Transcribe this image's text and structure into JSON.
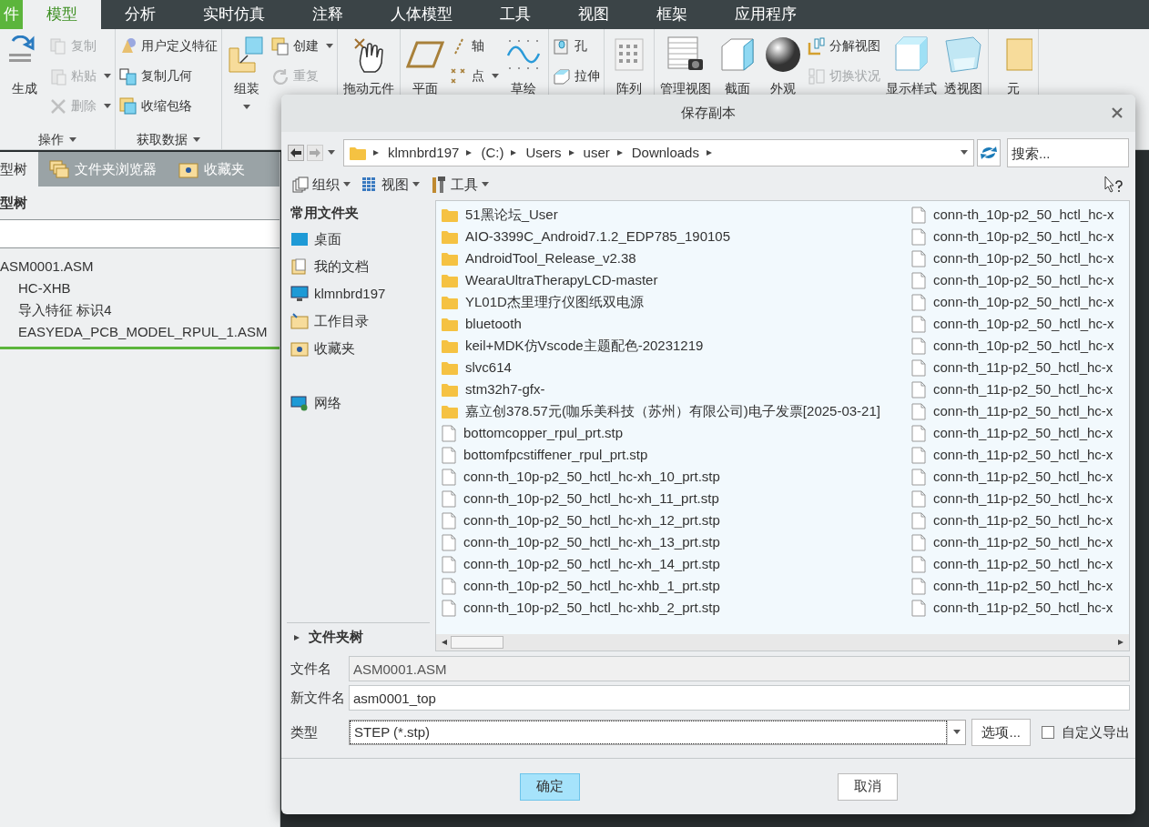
{
  "menu_tabs": [
    {
      "label": "件",
      "kind": "file",
      "selected": false
    },
    {
      "label": "模型",
      "kind": "tab",
      "selected": true
    },
    {
      "label": "分析",
      "kind": "tab",
      "selected": false
    },
    {
      "label": "实时仿真",
      "kind": "tab",
      "selected": false
    },
    {
      "label": "注释",
      "kind": "tab",
      "selected": false
    },
    {
      "label": "人体模型",
      "kind": "tab",
      "selected": false
    },
    {
      "label": "工具",
      "kind": "tab",
      "selected": false
    },
    {
      "label": "视图",
      "kind": "tab",
      "selected": false
    },
    {
      "label": "框架",
      "kind": "tab",
      "selected": false
    },
    {
      "label": "应用程序",
      "kind": "tab",
      "selected": false
    }
  ],
  "ribbon": {
    "groups": [
      {
        "label": "操作",
        "columns": [
          [
            {
              "label": "生成",
              "kind": "large",
              "disabled": false,
              "dropdown": false
            }
          ],
          [
            {
              "label": "复制",
              "kind": "small",
              "disabled": true,
              "dropdown": false
            },
            {
              "label": "粘贴",
              "kind": "small",
              "disabled": true,
              "dropdown": true
            },
            {
              "label": "删除",
              "kind": "small",
              "disabled": true,
              "dropdown": true
            }
          ]
        ]
      },
      {
        "label": "获取数据",
        "columns": [
          [
            {
              "label": "用户定义特征",
              "kind": "small",
              "disabled": false,
              "dropdown": false
            },
            {
              "label": "复制几何",
              "kind": "small",
              "disabled": false,
              "dropdown": false
            },
            {
              "label": "收缩包络",
              "kind": "small",
              "disabled": false,
              "dropdown": false
            }
          ]
        ]
      },
      {
        "columns": [
          [
            {
              "label": "组装",
              "kind": "large",
              "disabled": false,
              "dropdown": true
            }
          ],
          [
            {
              "label": "创建",
              "kind": "small",
              "disabled": false,
              "dropdown": true
            },
            {
              "label": "重复",
              "kind": "small",
              "disabled": true,
              "dropdown": false
            }
          ]
        ]
      },
      {
        "columns": [
          [
            {
              "label": "拖动元件",
              "kind": "large",
              "disabled": false,
              "dropdown": false
            }
          ]
        ]
      },
      {
        "columns": [
          [
            {
              "label": "平面",
              "kind": "large",
              "disabled": false,
              "dropdown": false
            }
          ],
          [
            {
              "label": "轴",
              "kind": "small",
              "disabled": false,
              "dropdown": false
            },
            {
              "label": "点",
              "kind": "small",
              "disabled": false,
              "dropdown": true
            }
          ],
          [
            {
              "label": "草绘",
              "kind": "large",
              "disabled": false,
              "dropdown": false
            }
          ]
        ]
      },
      {
        "columns": [
          [
            {
              "label": "孔",
              "kind": "small",
              "disabled": false,
              "dropdown": false
            },
            {
              "label": "拉伸",
              "kind": "small",
              "disabled": false,
              "dropdown": false
            }
          ]
        ]
      },
      {
        "columns": [
          [
            {
              "label": "阵列",
              "kind": "large",
              "disabled": false,
              "dropdown": false
            }
          ]
        ]
      },
      {
        "columns": [
          [
            {
              "label": "管理视图",
              "kind": "large",
              "disabled": false,
              "dropdown": false
            }
          ],
          [
            {
              "label": "截面",
              "kind": "large",
              "disabled": false,
              "dropdown": false
            }
          ],
          [
            {
              "label": "外观",
              "kind": "large",
              "disabled": false,
              "dropdown": false
            }
          ],
          [
            {
              "label": "分解视图",
              "kind": "small",
              "disabled": false,
              "dropdown": false
            },
            {
              "label": "切换状况",
              "kind": "small",
              "disabled": true,
              "dropdown": false
            }
          ],
          [
            {
              "label": "显示样式",
              "kind": "large",
              "disabled": false,
              "dropdown": false
            }
          ],
          [
            {
              "label": "透视图",
              "kind": "large",
              "disabled": false,
              "dropdown": false
            }
          ]
        ]
      },
      {
        "columns": [
          [
            {
              "label": "元",
              "kind": "large",
              "disabled": false,
              "dropdown": false
            }
          ]
        ]
      }
    ]
  },
  "left_panel": {
    "tabs": [
      {
        "label": "型树",
        "selected": true
      },
      {
        "label": "文件夹浏览器",
        "selected": false
      },
      {
        "label": "收藏夹",
        "selected": false
      }
    ],
    "heading": "型树",
    "tree": [
      {
        "label": "ASM0001.ASM",
        "children": [
          {
            "label": "HC-XHB"
          },
          {
            "label": "导入特征 标识4"
          },
          {
            "label": "EASYEDA_PCB_MODEL_RPUL_1.ASM"
          }
        ]
      }
    ]
  },
  "dialog": {
    "title": "保存副本",
    "address": [
      "klmnbrd197",
      "(C:)",
      "Users",
      "user",
      "Downloads"
    ],
    "search": {
      "placeholder": "搜索..."
    },
    "toolbar": [
      "组织",
      "视图",
      "工具"
    ],
    "nav": {
      "heading": "常用文件夹",
      "items": [
        {
          "label": "桌面"
        },
        {
          "label": "我的文档"
        },
        {
          "label": "klmnbrd197"
        },
        {
          "label": "工作目录"
        },
        {
          "label": "收藏夹"
        }
      ],
      "network_items": [
        {
          "label": "网络"
        }
      ],
      "folder_tree": "文件夹树"
    },
    "files": {
      "column_1": [
        {
          "name": "51黑论坛_User",
          "kind": "folder"
        },
        {
          "name": "AIO-3399C_Android7.1.2_EDP785_190105",
          "kind": "folder"
        },
        {
          "name": "AndroidTool_Release_v2.38",
          "kind": "folder"
        },
        {
          "name": "WearaUltraTherapyLCD-master",
          "kind": "folder"
        },
        {
          "name": "YL01D杰里理疗仪图纸双电源",
          "kind": "folder"
        },
        {
          "name": "bluetooth",
          "kind": "folder"
        },
        {
          "name": "keil+MDK仿Vscode主题配色-20231219",
          "kind": "folder"
        },
        {
          "name": "slvc614",
          "kind": "folder"
        },
        {
          "name": "stm32h7-gfx-",
          "kind": "folder"
        },
        {
          "name": "嘉立创378.57元(咖乐美科技（苏州）有限公司)电子发票[2025-03-21]",
          "kind": "folder"
        },
        {
          "name": "bottomcopper_rpul_prt.stp",
          "kind": "file"
        },
        {
          "name": "bottomfpcstiffener_rpul_prt.stp",
          "kind": "file"
        },
        {
          "name": "conn-th_10p-p2_50_hctl_hc-xh_10_prt.stp",
          "kind": "file"
        },
        {
          "name": "conn-th_10p-p2_50_hctl_hc-xh_11_prt.stp",
          "kind": "file"
        },
        {
          "name": "conn-th_10p-p2_50_hctl_hc-xh_12_prt.stp",
          "kind": "file"
        },
        {
          "name": "conn-th_10p-p2_50_hctl_hc-xh_13_prt.stp",
          "kind": "file"
        },
        {
          "name": "conn-th_10p-p2_50_hctl_hc-xh_14_prt.stp",
          "kind": "file"
        },
        {
          "name": "conn-th_10p-p2_50_hctl_hc-xhb_1_prt.stp",
          "kind": "file"
        },
        {
          "name": "conn-th_10p-p2_50_hctl_hc-xhb_2_prt.stp",
          "kind": "file"
        }
      ],
      "column_2": [
        {
          "name": "conn-th_10p-p2_50_hctl_hc-x",
          "kind": "file"
        },
        {
          "name": "conn-th_10p-p2_50_hctl_hc-x",
          "kind": "file"
        },
        {
          "name": "conn-th_10p-p2_50_hctl_hc-x",
          "kind": "file"
        },
        {
          "name": "conn-th_10p-p2_50_hctl_hc-x",
          "kind": "file"
        },
        {
          "name": "conn-th_10p-p2_50_hctl_hc-x",
          "kind": "file"
        },
        {
          "name": "conn-th_10p-p2_50_hctl_hc-x",
          "kind": "file"
        },
        {
          "name": "conn-th_10p-p2_50_hctl_hc-x",
          "kind": "file"
        },
        {
          "name": "conn-th_11p-p2_50_hctl_hc-x",
          "kind": "file"
        },
        {
          "name": "conn-th_11p-p2_50_hctl_hc-x",
          "kind": "file"
        },
        {
          "name": "conn-th_11p-p2_50_hctl_hc-x",
          "kind": "file"
        },
        {
          "name": "conn-th_11p-p2_50_hctl_hc-x",
          "kind": "file"
        },
        {
          "name": "conn-th_11p-p2_50_hctl_hc-x",
          "kind": "file"
        },
        {
          "name": "conn-th_11p-p2_50_hctl_hc-x",
          "kind": "file"
        },
        {
          "name": "conn-th_11p-p2_50_hctl_hc-x",
          "kind": "file"
        },
        {
          "name": "conn-th_11p-p2_50_hctl_hc-x",
          "kind": "file"
        },
        {
          "name": "conn-th_11p-p2_50_hctl_hc-x",
          "kind": "file"
        },
        {
          "name": "conn-th_11p-p2_50_hctl_hc-x",
          "kind": "file"
        },
        {
          "name": "conn-th_11p-p2_50_hctl_hc-x",
          "kind": "file"
        },
        {
          "name": "conn-th_11p-p2_50_hctl_hc-x",
          "kind": "file"
        }
      ]
    },
    "form": {
      "file_name_label": "文件名",
      "file_name": "ASM0001.ASM",
      "new_name_label": "新文件名",
      "new_name": "asm0001_top",
      "type_label": "类型",
      "type": "STEP (*.stp)",
      "options_button": "选项...",
      "custom_export": {
        "label": "自定义导出",
        "checked": false
      }
    },
    "buttons": [
      {
        "label": "确定",
        "default": true
      },
      {
        "label": "取消",
        "default": false
      }
    ]
  }
}
